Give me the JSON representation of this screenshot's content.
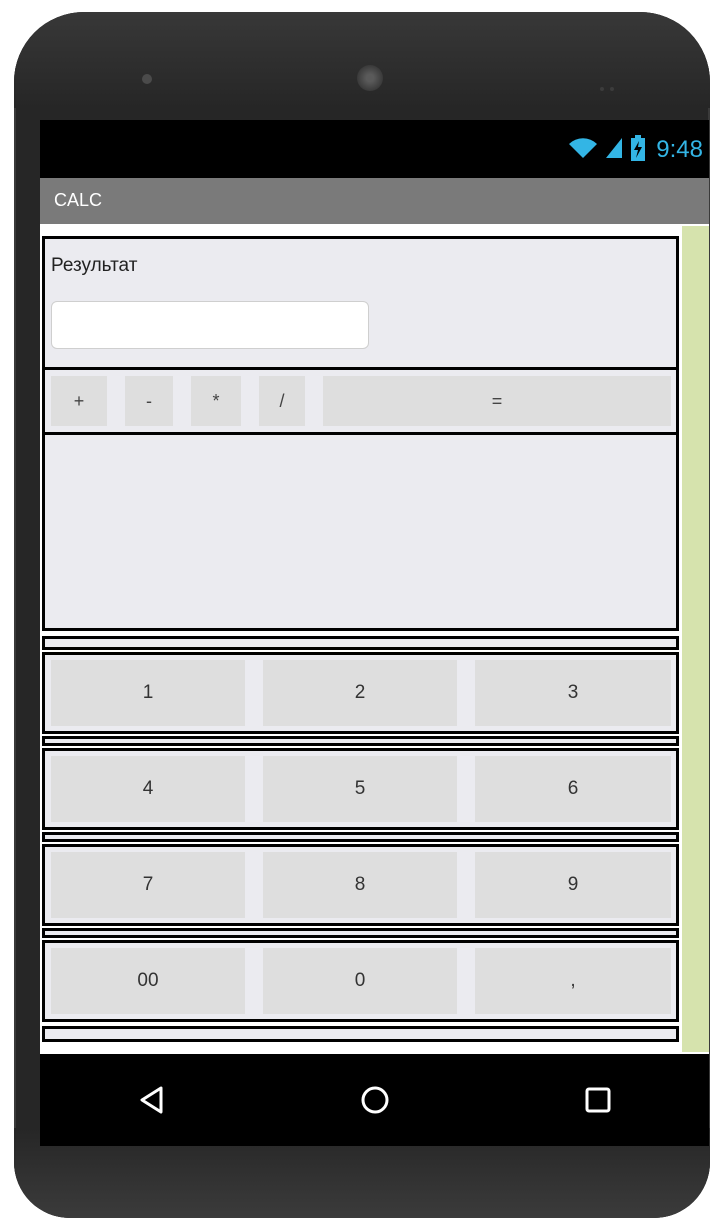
{
  "status_bar": {
    "time": "9:48",
    "icons": [
      "wifi-icon",
      "signal-icon",
      "battery-charging-icon"
    ],
    "accent_color": "#33b5e5"
  },
  "app_bar": {
    "title": "CALC"
  },
  "result": {
    "label": "Результат",
    "value": "",
    "placeholder": ""
  },
  "operators": [
    "+",
    "-",
    "*",
    "/",
    "="
  ],
  "keypad": [
    [
      "1",
      "2",
      "3"
    ],
    [
      "4",
      "5",
      "6"
    ],
    [
      "7",
      "8",
      "9"
    ],
    [
      "00",
      "0",
      ","
    ]
  ],
  "nav_bar": {
    "icons": [
      "back-icon",
      "home-icon",
      "recents-icon"
    ]
  },
  "colors": {
    "app_bar": "#7a7a7a",
    "button": "#dedede",
    "scroll_strip": "#d6e3ad"
  }
}
